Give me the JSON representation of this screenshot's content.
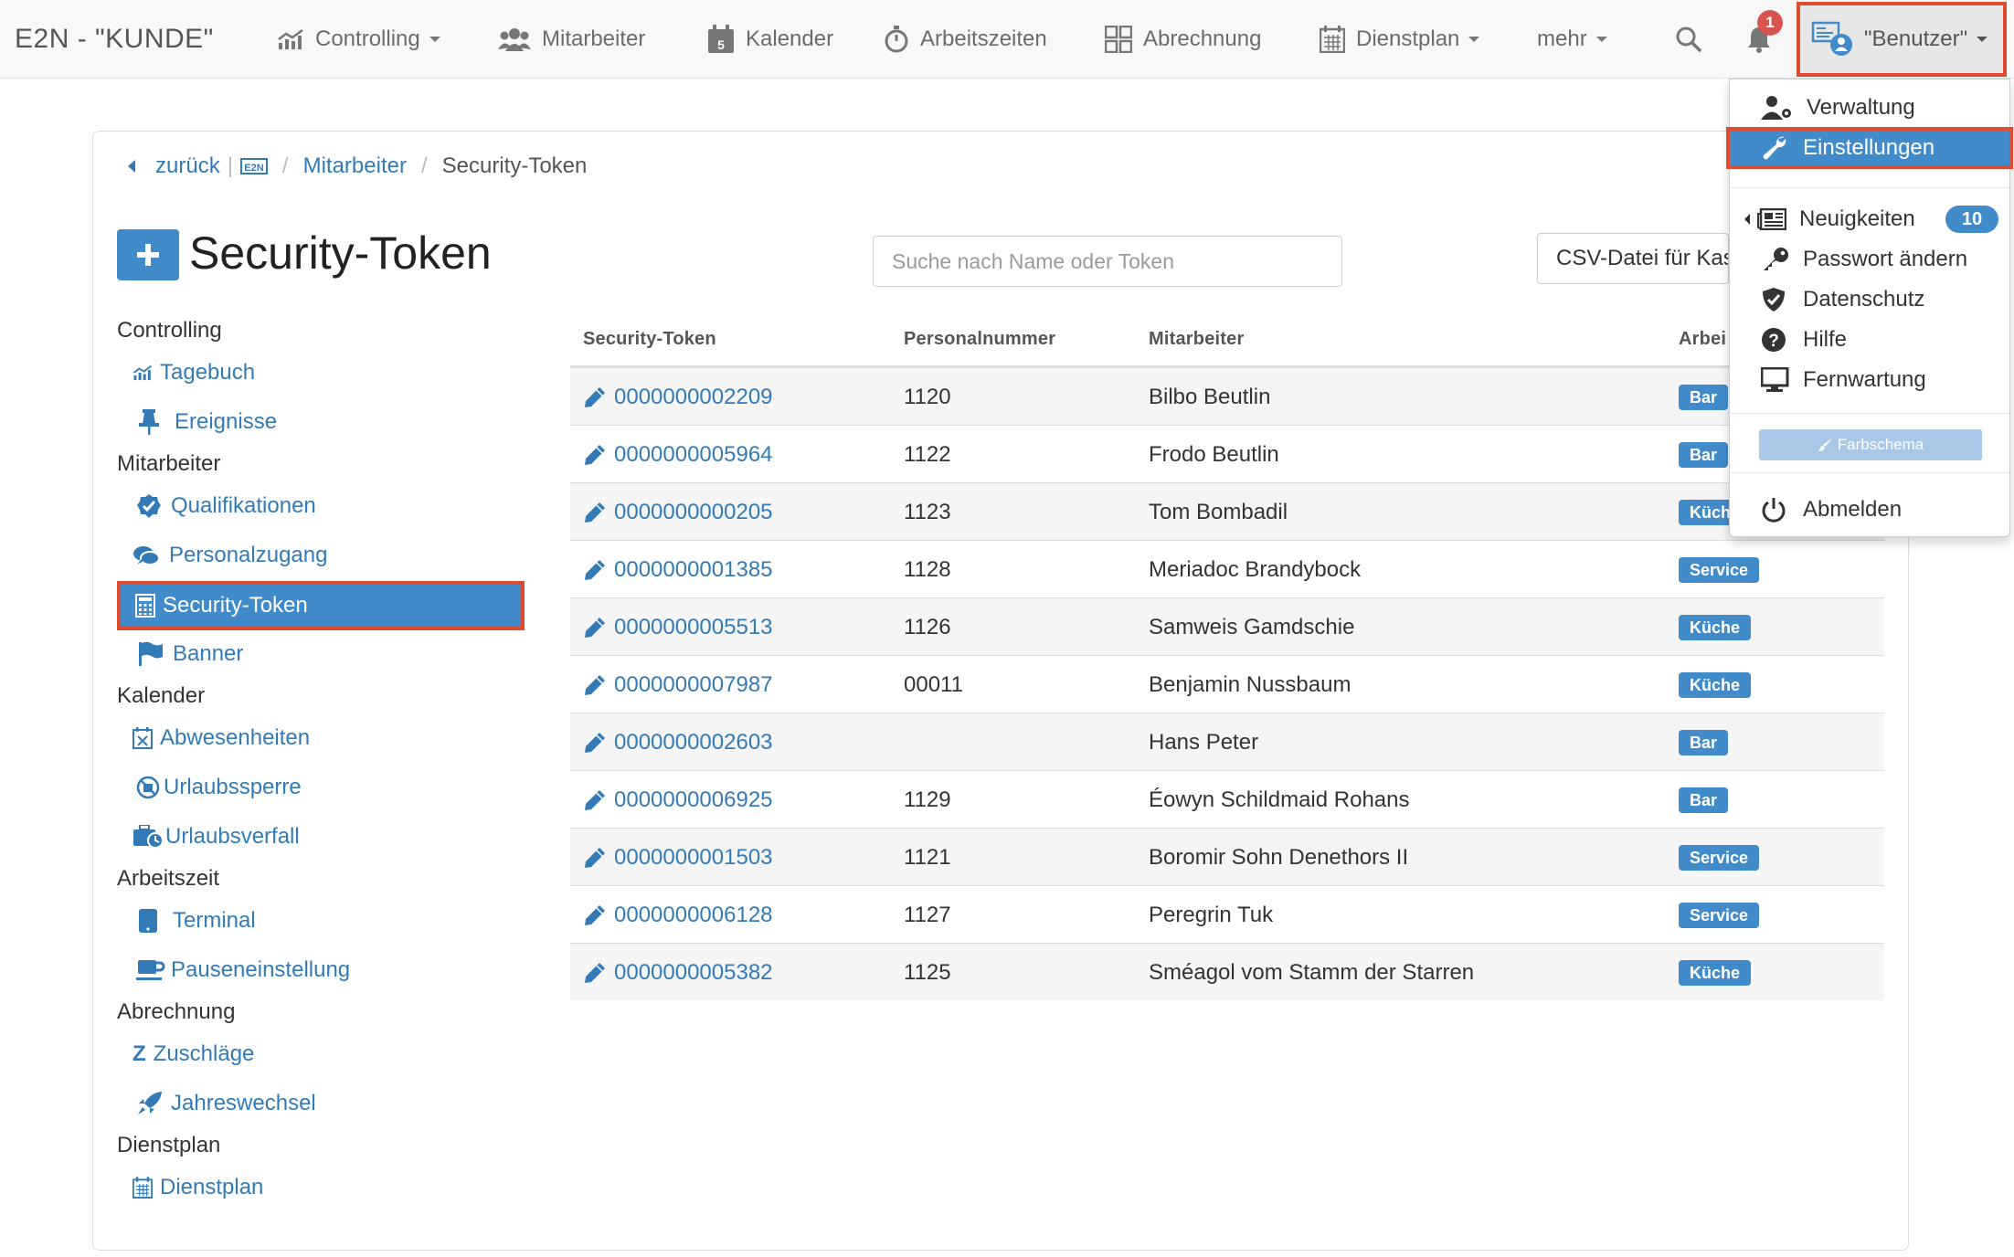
{
  "navbar": {
    "brand": "E2N - \"KUNDE\"",
    "items": [
      {
        "label": "Controlling",
        "icon": "chart-icon",
        "dropdown": true
      },
      {
        "label": "Mitarbeiter",
        "icon": "users-icon",
        "dropdown": false
      },
      {
        "label": "Kalender",
        "icon": "calendar-icon",
        "dropdown": false
      },
      {
        "label": "Arbeitszeiten",
        "icon": "stopwatch-icon",
        "dropdown": false
      },
      {
        "label": "Abrechnung",
        "icon": "grid-icon",
        "dropdown": false
      },
      {
        "label": "Dienstplan",
        "icon": "calendar-grid-icon",
        "dropdown": true
      },
      {
        "label": "mehr",
        "icon": "",
        "dropdown": true
      }
    ],
    "notification_count": "1",
    "user_label": "\"Benutzer\""
  },
  "breadcrumb": {
    "back": "zurück",
    "items": [
      "Mitarbeiter",
      "Security-Token"
    ]
  },
  "page": {
    "title": "Security-Token",
    "search_placeholder": "Suche nach Name oder Token",
    "csv_button": "CSV-Datei für Kas"
  },
  "sidebar": {
    "sections": [
      {
        "heading": "Controlling",
        "items": [
          "Tagebuch",
          "Ereignisse"
        ]
      },
      {
        "heading": "Mitarbeiter",
        "items": [
          "Qualifikationen",
          "Personalzugang",
          "Security-Token",
          "Banner"
        ]
      },
      {
        "heading": "Kalender",
        "items": [
          "Abwesenheiten",
          "Urlaubssperre",
          "Urlaubsverfall"
        ]
      },
      {
        "heading": "Arbeitszeit",
        "items": [
          "Terminal",
          "Pauseneinstellung"
        ]
      },
      {
        "heading": "Abrechnung",
        "items": [
          "Zuschläge",
          "Jahreswechsel"
        ]
      },
      {
        "heading": "Dienstplan",
        "items": [
          "Dienstplan"
        ]
      }
    ]
  },
  "table": {
    "headers": [
      "Security-Token",
      "Personalnummer",
      "Mitarbeiter",
      "Arbei"
    ],
    "rows": [
      {
        "token": "0000000002209",
        "pnr": "1120",
        "name": "Bilbo Beutlin",
        "area": "Bar"
      },
      {
        "token": "0000000005964",
        "pnr": "1122",
        "name": "Frodo Beutlin",
        "area": "Bar"
      },
      {
        "token": "0000000000205",
        "pnr": "1123",
        "name": "Tom Bombadil",
        "area": "Küch"
      },
      {
        "token": "0000000001385",
        "pnr": "1128",
        "name": "Meriadoc Brandybock",
        "area": "Service"
      },
      {
        "token": "0000000005513",
        "pnr": "1126",
        "name": "Samweis Gamdschie",
        "area": "Küche"
      },
      {
        "token": "0000000007987",
        "pnr": "00011",
        "name": "Benjamin Nussbaum",
        "area": "Küche"
      },
      {
        "token": "0000000002603",
        "pnr": "",
        "name": "Hans Peter",
        "area": "Bar"
      },
      {
        "token": "0000000006925",
        "pnr": "1129",
        "name": "Éowyn Schildmaid Rohans",
        "area": "Bar"
      },
      {
        "token": "0000000001503",
        "pnr": "1121",
        "name": "Boromir Sohn Denethors II",
        "area": "Service"
      },
      {
        "token": "0000000006128",
        "pnr": "1127",
        "name": "Peregrin Tuk",
        "area": "Service"
      },
      {
        "token": "0000000005382",
        "pnr": "1125",
        "name": "Sméagol vom Stamm der Starren",
        "area": "Küche"
      }
    ]
  },
  "dropdown": {
    "items": [
      {
        "label": "Verwaltung",
        "icon": "user-gear-icon"
      },
      {
        "label": "Einstellungen",
        "icon": "wrench-icon"
      },
      {
        "label": "Neuigkeiten",
        "icon": "newspaper-icon",
        "badge": "10"
      },
      {
        "label": "Passwort ändern",
        "icon": "key-icon"
      },
      {
        "label": "Datenschutz",
        "icon": "shield-icon"
      },
      {
        "label": "Hilfe",
        "icon": "question-circle-icon"
      },
      {
        "label": "Fernwartung",
        "icon": "monitor-icon"
      },
      {
        "label": "Abmelden",
        "icon": "power-icon"
      }
    ],
    "farbschema_label": "Farbschema"
  },
  "colors": {
    "primary": "#428bca",
    "link": "#337ab7",
    "highlight_border": "#e04a2e",
    "notification": "#d9534f"
  }
}
